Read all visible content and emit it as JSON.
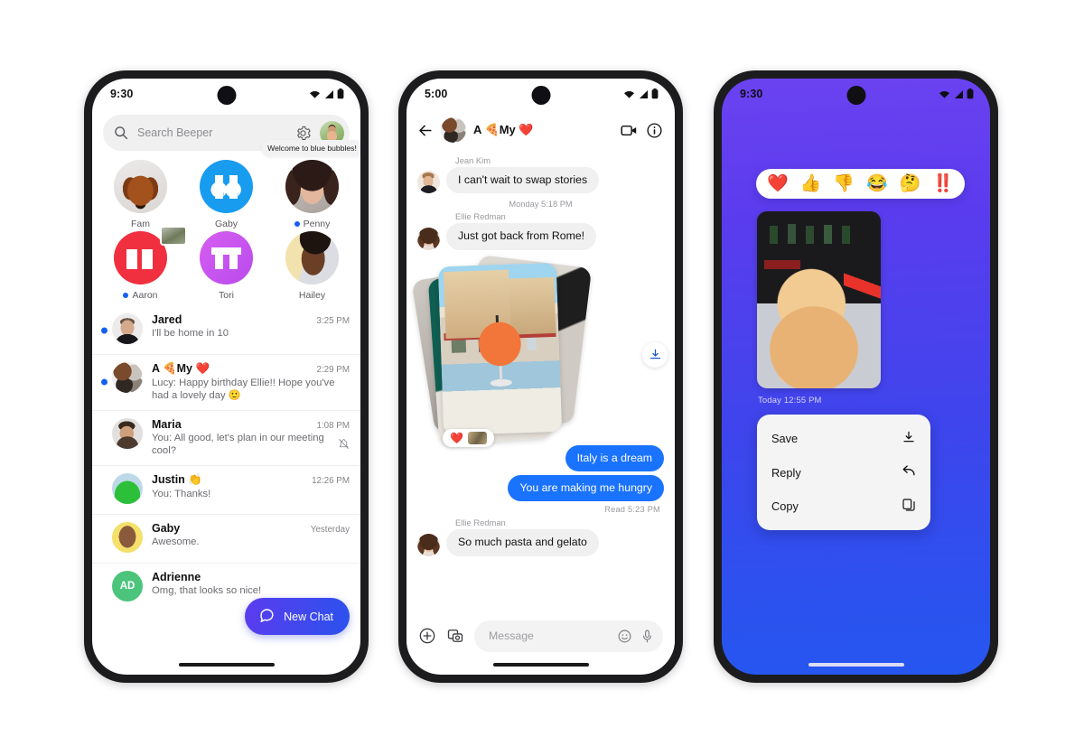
{
  "phones": [
    {
      "id": "inbox",
      "status": {
        "time": "9:30",
        "icons": [
          "wifi-icon",
          "cellular-icon",
          "battery-icon"
        ]
      },
      "search": {
        "placeholder": "Search Beeper",
        "value": "",
        "icons": [
          "search-icon",
          "gear-icon",
          "profile-avatar"
        ]
      },
      "favorites": [
        {
          "name": "Fam",
          "unread": false,
          "avatar_kind": "photo-dog-dachshund",
          "badge": false,
          "tooltip": ""
        },
        {
          "name": "Gaby",
          "unread": false,
          "avatar_kind": "logo-beeper-blue",
          "badge": false,
          "tooltip": ""
        },
        {
          "name": "Penny",
          "unread": true,
          "avatar_kind": "photo-woman-dark-hair",
          "badge": false,
          "tooltip": "Welcome to blue bubbles!"
        },
        {
          "name": "Aaron",
          "unread": true,
          "avatar_kind": "logo-red-initials",
          "badge": true,
          "tooltip": ""
        },
        {
          "name": "Tori",
          "unread": false,
          "avatar_kind": "logo-purple-ts",
          "badge": false,
          "tooltip": ""
        },
        {
          "name": "Hailey",
          "unread": false,
          "avatar_kind": "photo-woman-smiling",
          "badge": false,
          "tooltip": ""
        }
      ],
      "chats": [
        {
          "name": "Jared",
          "emoji": "",
          "time": "3:25 PM",
          "preview": "I'll be home in 10",
          "unread": true,
          "muted": false,
          "avatar_kind": "photo-man-black-shirt",
          "initials": ""
        },
        {
          "name": "A 🍕My ❤️",
          "emoji": "",
          "time": "2:29 PM",
          "preview": "Lucy: Happy birthday Ellie!! Hope you've had a lovely day  🙂",
          "unread": true,
          "muted": false,
          "avatar_kind": "group-cluster",
          "initials": ""
        },
        {
          "name": "Maria",
          "emoji": "",
          "time": "1:08 PM",
          "preview": "You: All good, let's plan in our meeting cool?",
          "unread": false,
          "muted": true,
          "avatar_kind": "photo-woman-maria",
          "initials": ""
        },
        {
          "name": "Justin 👏",
          "emoji": "",
          "time": "12:26 PM",
          "preview": "You: Thanks!",
          "unread": false,
          "muted": false,
          "avatar_kind": "photo-green-hoodie",
          "initials": ""
        },
        {
          "name": "Gaby",
          "emoji": "",
          "time": "Yesterday",
          "preview": "Awesome.",
          "unread": false,
          "muted": false,
          "avatar_kind": "photo-memoji-yellow",
          "initials": ""
        },
        {
          "name": "Adrienne",
          "emoji": "",
          "time": "",
          "preview": "Omg, that looks so nice!",
          "unread": false,
          "muted": false,
          "avatar_kind": "initials-green",
          "initials": "AD"
        }
      ],
      "fab": {
        "label": "New Chat",
        "icon": "chat-bubble-icon"
      }
    },
    {
      "id": "conversation",
      "status": {
        "time": "5:00",
        "icons": [
          "wifi-icon",
          "cellular-icon",
          "battery-icon"
        ]
      },
      "header": {
        "title": "A 🍕My ❤️",
        "back_icon": "back-arrow-icon",
        "actions": [
          "video-call-icon",
          "info-icon"
        ]
      },
      "messages": [
        {
          "type": "incoming",
          "sender": "Jean Kim",
          "text": "I can't wait to swap stories",
          "avatar_kind": "photo-woman-jean"
        },
        {
          "type": "daystamp",
          "text": "Monday 5:18 PM"
        },
        {
          "type": "incoming",
          "sender": "Ellie Redman",
          "text": "Just got back from Rome!",
          "avatar_kind": "photo-woman-ellie"
        },
        {
          "type": "photostack",
          "reaction": "❤️",
          "reaction_thumb": "photo-thumb",
          "download_icon": "download-icon"
        },
        {
          "type": "outgoing",
          "text": "Italy is a dream"
        },
        {
          "type": "outgoing",
          "text": "You are making me hungry"
        },
        {
          "type": "readstamp",
          "text": "Read  5:23 PM"
        },
        {
          "type": "incoming",
          "sender": "Ellie Redman",
          "text": "So much pasta and gelato",
          "avatar_kind": "photo-woman-ellie"
        }
      ],
      "composer": {
        "placeholder": "Message",
        "value": "",
        "left_icons": [
          "plus-circle-icon",
          "photo-camera-icon"
        ],
        "right_icons": [
          "emoji-icon",
          "microphone-icon"
        ]
      }
    },
    {
      "id": "reaction-menu",
      "status": {
        "time": "9:30",
        "icons": [
          "wifi-icon",
          "cellular-icon",
          "battery-icon"
        ]
      },
      "reactions": [
        "❤️",
        "👍",
        "👎",
        "😂",
        "🤔",
        "‼️"
      ],
      "photo": {
        "alt": "photo-chow-dog-sunglasses",
        "timestamp": "Today  12:55 PM"
      },
      "menu": [
        {
          "label": "Save",
          "icon": "download-icon"
        },
        {
          "label": "Reply",
          "icon": "reply-arrow-icon"
        },
        {
          "label": "Copy",
          "icon": "copy-icon"
        }
      ],
      "background": {
        "from": "#6B42F0",
        "to": "#2656F0"
      }
    }
  ],
  "theme": {
    "accent_blue": "#1a73ff",
    "unread_dot": "#1560f0",
    "fab_from": "#5B3CEE",
    "fab_to": "#2B52EE",
    "bubble_in": "#f0f0f0",
    "bubble_out": "#1a73ff"
  }
}
